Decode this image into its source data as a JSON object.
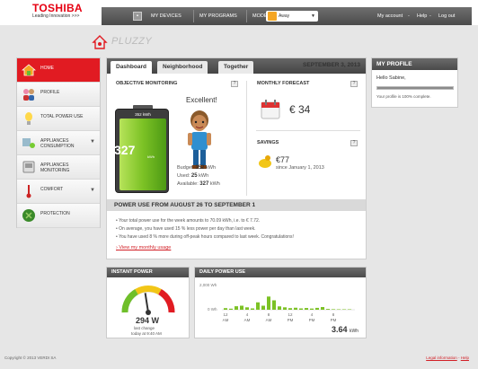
{
  "header": {
    "brand": "TOSHIBA",
    "tagline": "Leading Innovation >>>",
    "nav": {
      "my_devices": "MY DEVICES",
      "my_programs": "MY PROGRAMS",
      "mode_label": "MODE",
      "mode_value": "Away",
      "my_account": "My account",
      "help": "Help",
      "logout": "Log out",
      "separator": "-"
    }
  },
  "app": {
    "name": "PLUZZY"
  },
  "sidebar": {
    "items": [
      {
        "label": "HOME",
        "icon": "house-icon"
      },
      {
        "label": "PROFILE",
        "icon": "people-icon"
      },
      {
        "label": "TOTAL POWER USE",
        "icon": "lightbulb-icon"
      },
      {
        "label": "APPLIANCES CONSUMPTION",
        "icon": "appliances-icon"
      },
      {
        "label": "APPLIANCES MONITORING",
        "icon": "monitor-icon"
      },
      {
        "label": "COMFORT",
        "icon": "thermometer-icon"
      },
      {
        "label": "PROTECTION",
        "icon": "shield-icon"
      }
    ]
  },
  "main": {
    "tabs": [
      "Dashboard",
      "Neighborhood",
      "Together"
    ],
    "date": "SEPTEMBER 3, 2013",
    "objective": {
      "title": "OBJECTIVE MONITORING",
      "help": "?",
      "battery_top": "352 kWh",
      "battery_value": "327",
      "battery_unit": "kWh",
      "battery_fraction": 0.93,
      "status": "Excellent!",
      "budget_label": "Budget:",
      "budget_value": "352",
      "used_label": "Used:",
      "used_value": "25",
      "available_label": "Available:",
      "available_value": "327",
      "unit": "kWh"
    },
    "forecast": {
      "title": "MONTHLY FORECAST",
      "help": "?",
      "value": "€ 34"
    },
    "savings": {
      "title": "SAVINGS",
      "help": "?",
      "value": "€77",
      "since": "since January 1, 2013"
    },
    "power_use": {
      "title": "POWER USE FROM AUGUST 26 TO SEPTEMBER 1",
      "bullets": [
        "Your total power use for the week amounts to 70.09 kWh, i.e. to € 7.72.",
        "On average, you have used 15 % less power per day than last week.",
        "You have used 8 % more during off-peak hours compared to last week. Congratulations!"
      ],
      "link": "View my monthly usage"
    }
  },
  "profile": {
    "title": "MY PROFILE",
    "greeting": "Hello Sabine,",
    "completion": "Your profile is 100% complete.",
    "completion_fraction": 1.0
  },
  "instant": {
    "title": "INSTANT POWER",
    "value": "294 W",
    "sub1": "last change",
    "sub2": "today at 9:40 AM",
    "gauge_fraction": 0.45
  },
  "daily": {
    "title": "DAILY POWER USE",
    "y_top": "2,000 Wh",
    "y_zero": "0 Wh",
    "ticks": [
      [
        "12",
        "AM"
      ],
      [
        "4",
        "AM"
      ],
      [
        "8",
        "AM"
      ],
      [
        "12",
        "PM"
      ],
      [
        "4",
        "PM"
      ],
      [
        "8",
        "PM"
      ]
    ],
    "total": "3.64",
    "total_unit": "kWh"
  },
  "chart_data": {
    "type": "bar",
    "title": "DAILY POWER USE",
    "xlabel": "",
    "ylabel": "",
    "ylim": [
      0,
      2000
    ],
    "categories": [
      "12AM",
      "1",
      "2",
      "3",
      "4AM",
      "5",
      "6",
      "7",
      "8AM",
      "9",
      "10",
      "11",
      "12PM",
      "1",
      "2",
      "3",
      "4PM",
      "5",
      "6",
      "7",
      "8PM",
      "9",
      "10",
      "11"
    ],
    "values": [
      120,
      80,
      260,
      300,
      180,
      100,
      550,
      300,
      980,
      700,
      250,
      180,
      120,
      150,
      100,
      130,
      90,
      140,
      200,
      60,
      40,
      20,
      10,
      10
    ]
  },
  "footer": {
    "copyright": "Copyright © 2013 VERDI SA",
    "legal": "Legal information",
    "help": "Help"
  },
  "colors": {
    "accent": "#e11b22",
    "bar_green": "#7cc225",
    "dark": "#4a4a4a"
  }
}
